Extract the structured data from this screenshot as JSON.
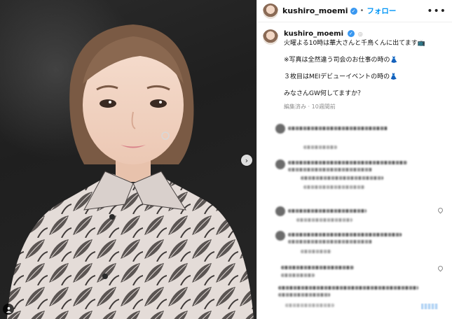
{
  "post": {
    "username": "kushiro_moemi",
    "follow_label": "フォロー",
    "more_label": "•••",
    "caption_lines": [
      "火曜よる10時は華大さんと千鳥くんに出てます📺",
      "※写真は全然違う司会のお仕事の時の👗",
      "３枚目はMEIデビューイベントの時の👗",
      "みなさんGW何してますか？"
    ],
    "meta": "編集済み · 10週間前"
  },
  "colors": {
    "accent": "#0095f6",
    "verified": "#3897f0"
  },
  "icons": {
    "next": "chevron-right-icon",
    "tag": "user-tag-icon",
    "verified": "verified-badge-icon"
  }
}
